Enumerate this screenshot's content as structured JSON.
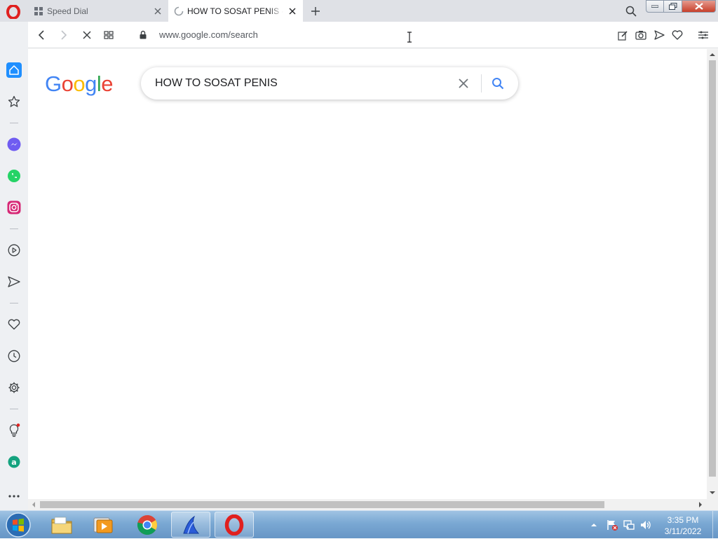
{
  "browser": {
    "tabs": [
      {
        "label": "Speed Dial",
        "icon": "speed-dial-grid-icon",
        "active": false
      },
      {
        "label": "HOW TO SOSAT PENIS - Google Search",
        "icon": "loading-spinner-icon",
        "active": true
      }
    ],
    "address": {
      "url": "www.google.com/search"
    }
  },
  "sidebar": {
    "items": [
      "home-icon",
      "bookmarks-star-icon",
      "messenger-icon",
      "whatsapp-icon",
      "instagram-icon",
      "player-icon",
      "flow-send-icon",
      "heart-icon",
      "history-icon",
      "settings-icon",
      "lightbulb-icon",
      "aria-icon",
      "more-icon"
    ]
  },
  "page": {
    "logo": {
      "letters": [
        "G",
        "o",
        "o",
        "g",
        "l",
        "e"
      ],
      "colors": [
        "#4285f4",
        "#ea4335",
        "#fbbc05",
        "#4285f4",
        "#34a853",
        "#ea4335"
      ]
    },
    "search": {
      "query": "HOW TO SOSAT PENIS"
    }
  },
  "taskbar": {
    "apps": [
      "file-explorer-icon",
      "media-player-icon",
      "chrome-icon",
      "shark-app-icon",
      "opera-icon"
    ],
    "clock": {
      "time": "3:35 PM",
      "date": "3/11/2022"
    }
  },
  "colors": {
    "accent": "#1a73e8",
    "opera_red": "#e0201f",
    "sidebar_active": "#1f8fff"
  }
}
